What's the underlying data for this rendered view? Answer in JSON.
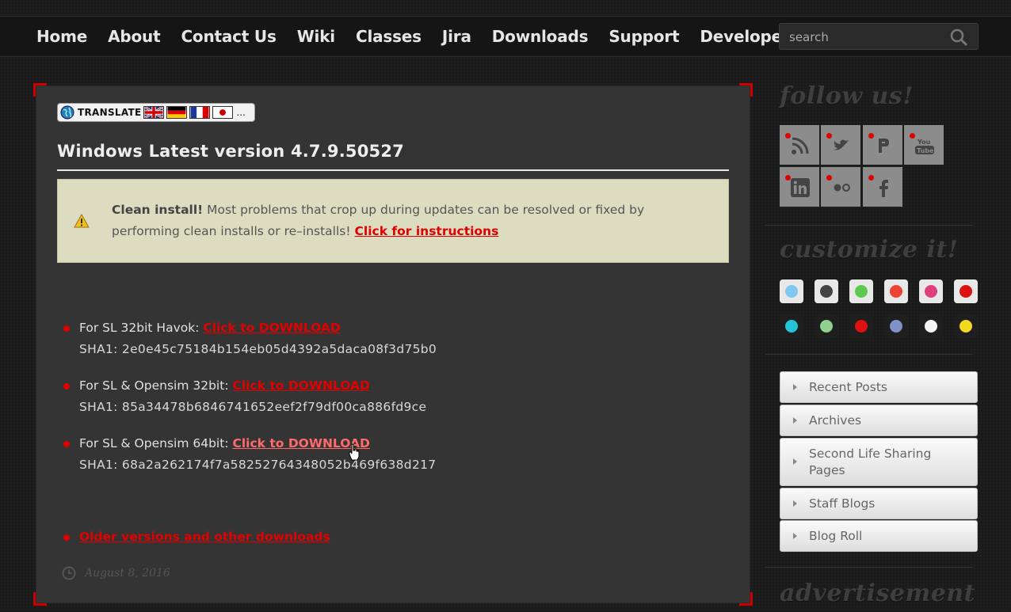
{
  "nav": {
    "items": [
      "Home",
      "About",
      "Contact Us",
      "Wiki",
      "Classes",
      "Jira",
      "Downloads",
      "Support",
      "Developers"
    ],
    "search_placeholder": "search"
  },
  "translate": {
    "label": "TRANSLATE",
    "more": "..."
  },
  "post": {
    "title": "Windows Latest version 4.7.9.50527",
    "notice": {
      "bold": "Clean install!",
      "text": " Most problems that crop up during updates can be resolved or fixed by performing clean installs or re–installs! ",
      "link": "Click for instructions"
    },
    "downloads": [
      {
        "label": "For SL 32bit Havok: ",
        "link": "Click to DOWNLOAD",
        "sha": "SHA1: 2e0e45c75184b154eb05d4392a5daca08f3d75b0"
      },
      {
        "label": "For SL & Opensim 32bit: ",
        "link": "Click to DOWNLOAD",
        "sha": "SHA1: 85a34478b6846741652eef2f79df00ca886fd9ce"
      },
      {
        "label": "For SL & Opensim 64bit: ",
        "link": "Click to DOWNLOAD",
        "sha": "SHA1: 68a2a262174f7a58252764348052b469f638d217"
      }
    ],
    "older_link": "Older versions and other downloads",
    "date": "August 8, 2016"
  },
  "sidebar": {
    "follow_heading": "follow us!",
    "social_icons": [
      "rss-icon",
      "twitter-icon",
      "plurk-icon",
      "youtube-icon",
      "linkedin-icon",
      "flickr-icon",
      "facebook-icon"
    ],
    "customize_heading": "customize it!",
    "swatch_colors": [
      "#7fc8f0",
      "#444444",
      "#5fc850",
      "#ee4433",
      "#e0407a",
      "#dd1111",
      "#22c4d8",
      "#90d090",
      "#dd1111",
      "#8090c8",
      "#f4f4f4",
      "#f2d820"
    ],
    "widgets": [
      "Recent Posts",
      "Archives",
      "Second Life Sharing Pages",
      "Staff Blogs",
      "Blog Roll"
    ],
    "ad_heading": "advertisement"
  },
  "colors": {
    "accent": "#e20000",
    "notice_bg": "#dcdcc0",
    "panel_bg": "#343434"
  }
}
